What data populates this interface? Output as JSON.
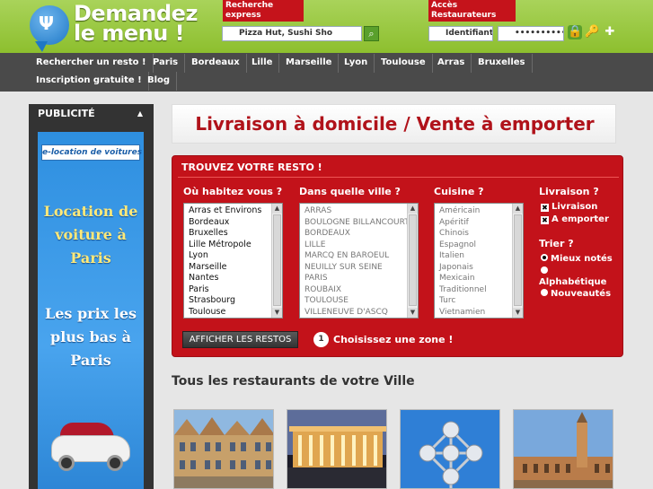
{
  "header": {
    "logo_line1": "Demandez",
    "logo_line2": "le menu !",
    "express_label": "Recherche express",
    "search_value": "Pizza Hut, Sushi Sho",
    "resto_label": "Accès Restaurateurs",
    "login_value": "Identifiant",
    "password_value": "••••••••••"
  },
  "nav": {
    "items": [
      "Rechercher un resto !",
      "Paris",
      "Bordeaux",
      "Lille",
      "Marseille",
      "Lyon",
      "Toulouse",
      "Arras",
      "Bruxelles",
      "Inscription gratuite !",
      "Blog"
    ]
  },
  "sidebar": {
    "title": "PUBLICITÉ",
    "ad_logo": "e-location de voitures",
    "ad_line1": "Location de voiture à Paris",
    "ad_line2": "Les prix les plus bas à Paris"
  },
  "banner": {
    "text": "Livraison à domicile / Vente à emporter"
  },
  "finder": {
    "title": "TROUVEZ VOTRE RESTO !",
    "col1_label": "Où habitez vous ?",
    "col2_label": "Dans quelle ville ?",
    "col3_label": "Cuisine ?",
    "col4_label": "Livraison ?",
    "zones": [
      "Arras et Environs",
      "Bordeaux",
      "Bruxelles",
      "Lille Métropole",
      "Lyon",
      "Marseille",
      "Nantes",
      "Paris",
      "Strasbourg",
      "Toulouse"
    ],
    "cities": [
      "ARRAS",
      "BOULOGNE BILLANCOURT",
      "BORDEAUX",
      "LILLE",
      "MARCQ EN BAROEUL",
      "NEUILLY SUR SEINE",
      "PARIS",
      "ROUBAIX",
      "TOULOUSE",
      "VILLENEUVE D'ASCQ"
    ],
    "cuisines": [
      "Américain",
      "Apéritif",
      "Chinois",
      "Espagnol",
      "Italien",
      "Japonais",
      "Mexicain",
      "Traditionnel",
      "Turc",
      "Vietnamien"
    ],
    "livraison_label": "Livraison",
    "emporter_label": "A emporter",
    "sort_label": "Trier ?",
    "sort_best": "Mieux notés",
    "sort_alpha": "Alphabétique",
    "sort_new": "Nouveautés",
    "button_label": "AFFICHER LES RESTOS",
    "step_number": "1",
    "step_text": "Choisissez une zone !"
  },
  "section": {
    "title": "Tous les restaurants de votre Ville"
  },
  "colors": {
    "brand_red": "#c3121a",
    "brand_green": "#8dbf2e",
    "nav_dark": "#4a4a4a"
  }
}
